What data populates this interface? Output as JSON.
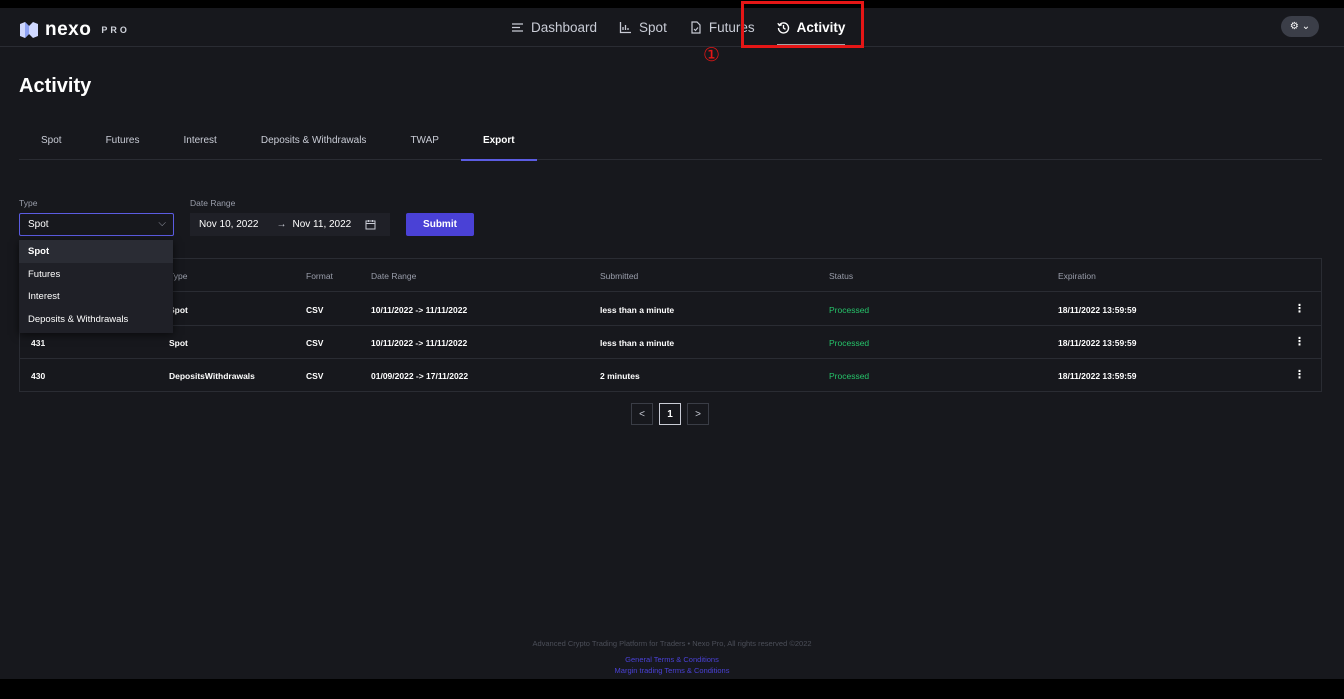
{
  "brand": {
    "name": "nexo",
    "suffix": "PRO"
  },
  "nav": {
    "items": [
      {
        "label": "Dashboard",
        "icon": "menu-lines-icon"
      },
      {
        "label": "Spot",
        "icon": "chart-icon"
      },
      {
        "label": "Futures",
        "icon": "document-icon"
      },
      {
        "label": "Activity",
        "icon": "history-icon"
      }
    ],
    "active": "Activity"
  },
  "annotation": {
    "number": "①",
    "color": "#e51616"
  },
  "page": {
    "title": "Activity"
  },
  "tabs": [
    "Spot",
    "Futures",
    "Interest",
    "Deposits & Withdrawals",
    "TWAP",
    "Export"
  ],
  "active_tab": "Export",
  "form": {
    "type_label": "Type",
    "type_value": "Spot",
    "date_range_label": "Date Range",
    "date_from": "Nov 10, 2022",
    "date_to": "Nov 11, 2022",
    "submit_label": "Submit"
  },
  "type_options": [
    "Spot",
    "Futures",
    "Interest",
    "Deposits & Withdrawals"
  ],
  "table": {
    "headers": [
      "Type",
      "Format",
      "Date Range",
      "Submitted",
      "Status",
      "Expiration"
    ],
    "rows": [
      {
        "id": "",
        "type": "Spot",
        "format": "CSV",
        "range": "10/11/2022 -> 11/11/2022",
        "submitted": "less than a minute",
        "status": "Processed",
        "expiration": "18/11/2022 13:59:59"
      },
      {
        "id": "431",
        "type": "Spot",
        "format": "CSV",
        "range": "10/11/2022 -> 11/11/2022",
        "submitted": "less than a minute",
        "status": "Processed",
        "expiration": "18/11/2022 13:59:59"
      },
      {
        "id": "430",
        "type": "DepositsWithdrawals",
        "format": "CSV",
        "range": "01/09/2022 -> 17/11/2022",
        "submitted": "2 minutes",
        "status": "Processed",
        "expiration": "18/11/2022 13:59:59"
      }
    ]
  },
  "pagination": {
    "current": "1",
    "prev": "<",
    "next": ">"
  },
  "footer": {
    "copyright": "Advanced Crypto Trading Platform for Traders • Nexo Pro, All rights reserved ©2022",
    "links": [
      "General Terms & Conditions",
      "Margin trading Terms & Conditions"
    ]
  },
  "colors": {
    "accent": "#5b5ce2",
    "button": "#4a41d6",
    "success": "#26c36a",
    "background": "#17181d"
  }
}
